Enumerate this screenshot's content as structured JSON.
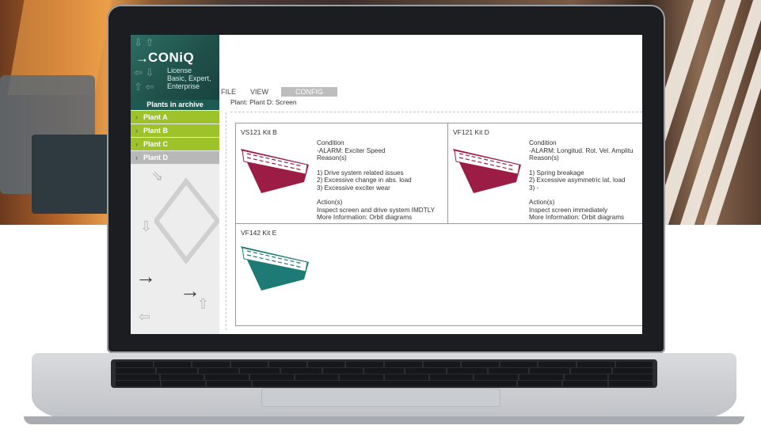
{
  "app": {
    "brand": "CONiQ",
    "license_lines": [
      "License",
      "Basic, Expert,",
      "Enterprise"
    ]
  },
  "sidebar": {
    "header": "Plants in archive",
    "plants": [
      {
        "label": "Plant A",
        "color": "#9dc22a"
      },
      {
        "label": "Plant B",
        "color": "#9dc22a"
      },
      {
        "label": "Plant C",
        "color": "#9dc22a"
      },
      {
        "label": "Plant D",
        "color": "#b8b8b8"
      }
    ]
  },
  "menu": {
    "items": [
      "FILE",
      "VIEW",
      "CONFIG"
    ],
    "active": "CONFIG"
  },
  "breadcrumb": "Plant: Plant D: Screen",
  "cards": [
    {
      "title": "VS121 Kit B",
      "icon": "screen-icon",
      "icon_color": "#9b1c45",
      "condition_label": "Condition",
      "condition": "-ALARM: Exciter Speed",
      "reasons_label": "Reason(s)",
      "reasons": [
        "1) Drive system related issues",
        "2) Excessive change in abs. load",
        "3) Excessive exciter wear"
      ],
      "actions_label": "Action(s)",
      "actions": [
        "Inspect screen and drive system IMDTLY",
        "More Information: Orbit diagrams"
      ]
    },
    {
      "title": "VF121 Kit D",
      "icon": "screen-icon",
      "icon_color": "#9b1c45",
      "condition_label": "Condition",
      "condition": "-ALARM: Longitud. Rot. Vel. Amplitu",
      "reasons_label": "Reason(s)",
      "reasons": [
        "1) Spring breakage",
        "2) Excessive asymmetric lat. load",
        "3) -"
      ],
      "actions_label": "Action(s)",
      "actions": [
        "Inspect screen immediately",
        "More Information: Orbit diagrams"
      ]
    },
    {
      "title": "VF142 Kit E",
      "icon": "screen-icon",
      "icon_color": "#1e7a74"
    }
  ]
}
